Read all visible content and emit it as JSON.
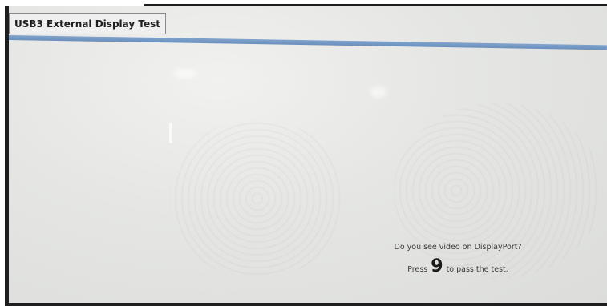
{
  "window": {
    "tab_title": "USB3 External Display Test"
  },
  "prompt": {
    "question": "Do you see video on DisplayPort?",
    "press_text": "Press",
    "key": "9",
    "pass_text": "to pass the test."
  },
  "colors": {
    "tab_underline": "#6a8fbd",
    "screen_background": "#e5e6e3",
    "bezel": "#1e1e1e"
  }
}
